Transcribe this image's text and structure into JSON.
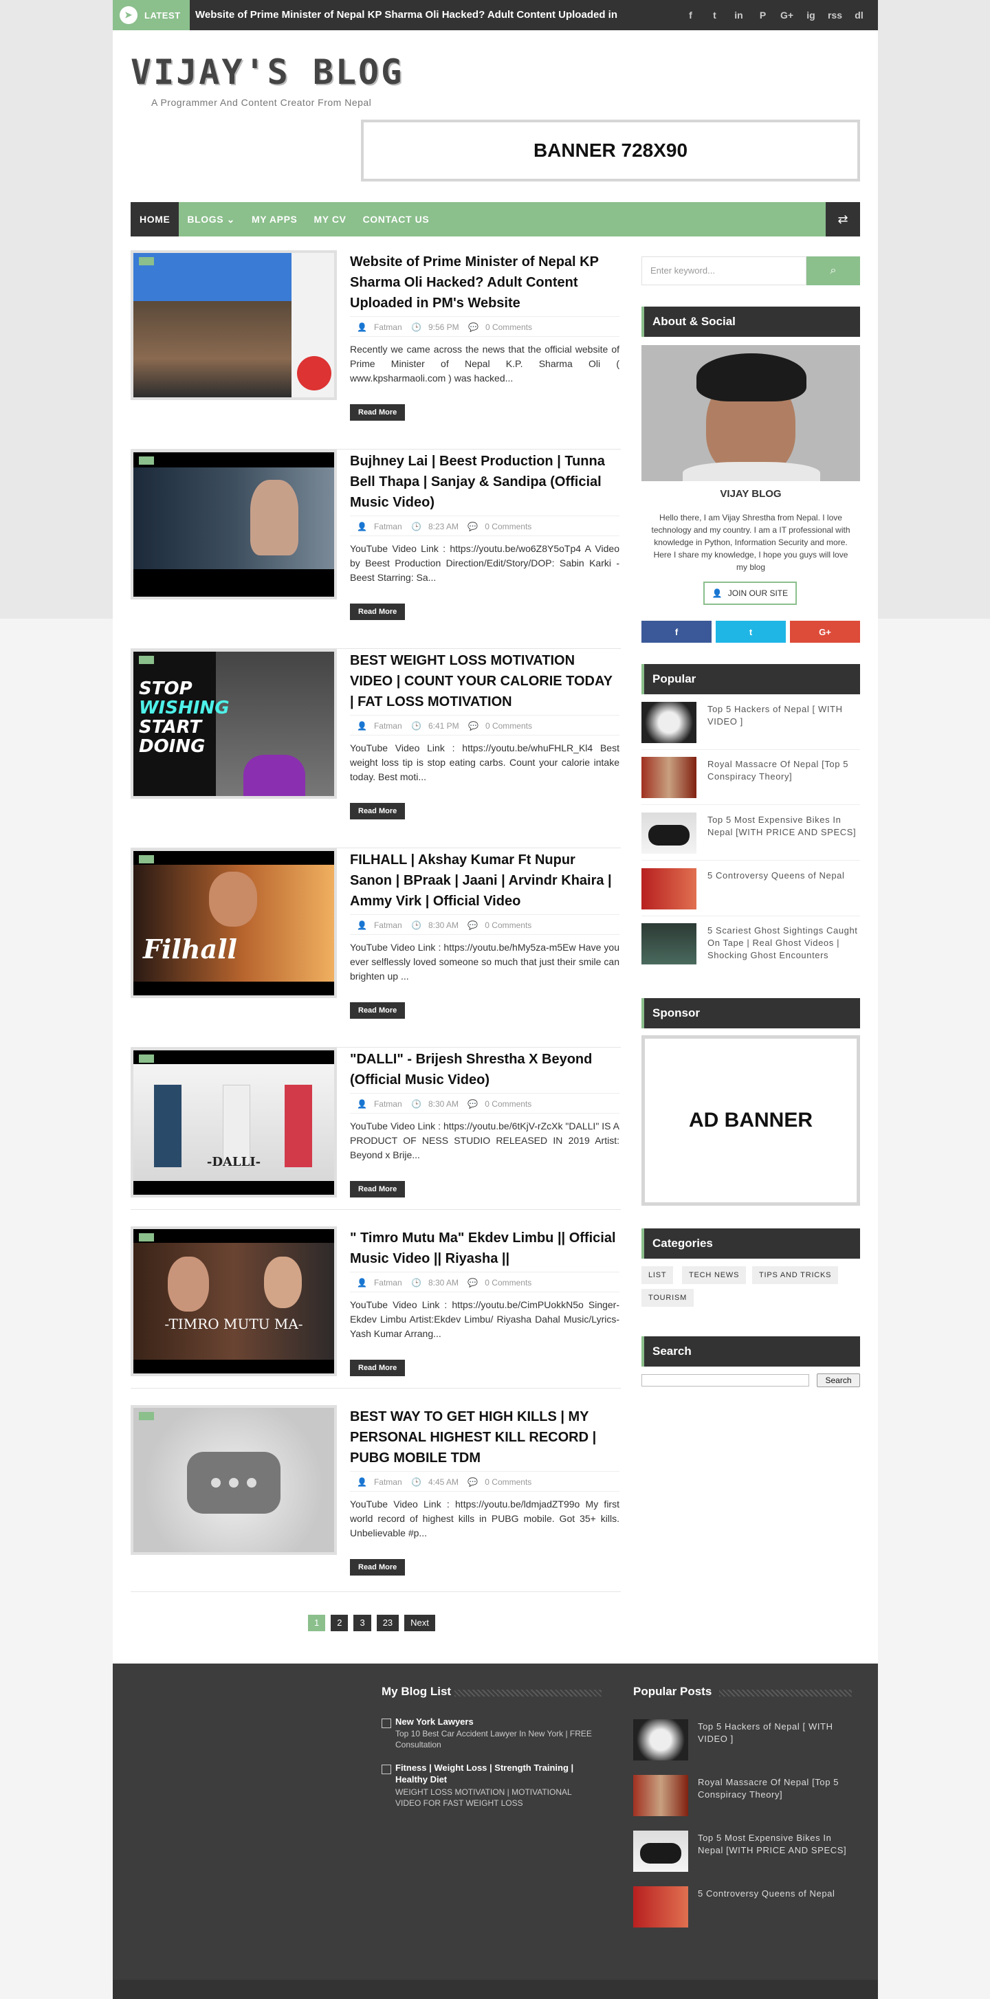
{
  "topbar": {
    "latest_label": "LATEST",
    "ticker": "Website of Prime Minister of Nepal KP Sharma Oli Hacked? Adult Content Uploaded in",
    "social": [
      "f",
      "t",
      "in",
      "P",
      "G+",
      "ig",
      "rss",
      "dl"
    ]
  },
  "header": {
    "logo": "VIJAY'S BLOG",
    "tagline": "A Programmer And Content Creator From Nepal",
    "banner": "BANNER 728X90"
  },
  "nav": {
    "items": [
      "HOME",
      "BLOGS ⌄",
      "MY APPS",
      "MY CV",
      "CONTACT US"
    ]
  },
  "posts": [
    {
      "title": "Website of Prime Minister of Nepal KP Sharma Oli Hacked? Adult Content Uploaded in PM's Website",
      "author": "Fatman",
      "time": "9:56 PM",
      "comments": "0 Comments",
      "excerpt": "Recently we came across the news that the official website of Prime Minister of Nepal K.P. Sharma Oli ( www.kpsharmaoli.com ) was hacked...",
      "read_more": "Read More"
    },
    {
      "title": "Bujhney Lai | Beest Production | Tunna Bell Thapa | Sanjay & Sandipa (Official Music Video)",
      "author": "Fatman",
      "time": "8:23 AM",
      "comments": "0 Comments",
      "excerpt": "YouTube Video Link : https://youtu.be/wo6Z8Y5oTp4 A Video by Beest Production Direction/Edit/Story/DOP: Sabin Karki -Beest Starring: Sa...",
      "read_more": "Read More"
    },
    {
      "title": "BEST WEIGHT LOSS MOTIVATION VIDEO | COUNT YOUR CALORIE TODAY | FAT LOSS MOTIVATION",
      "author": "Fatman",
      "time": "6:41 PM",
      "comments": "0 Comments",
      "excerpt": "YouTube Video Link : https://youtu.be/whuFHLR_Kl4 Best weight loss tip is stop eating carbs. Count your calorie intake today. Best moti...",
      "read_more": "Read More",
      "thumb_text": [
        "STOP",
        "WISHING",
        "START",
        "DOING"
      ]
    },
    {
      "title": "FILHALL | Akshay Kumar Ft Nupur Sanon | BPraak | Jaani | Arvindr Khaira | Ammy Virk | Official Video",
      "author": "Fatman",
      "time": "8:30 AM",
      "comments": "0 Comments",
      "excerpt": "YouTube Video Link : https://youtu.be/hMy5za-m5Ew Have you ever selflessly loved someone so much that just their smile can brighten up ...",
      "read_more": "Read More",
      "thumb_text": "Filhall"
    },
    {
      "title": "\"DALLI\" - Brijesh Shrestha X Beyond (Official Music Video)",
      "author": "Fatman",
      "time": "8:30 AM",
      "comments": "0 Comments",
      "excerpt": "YouTube Video Link : https://youtu.be/6tKjV-rZcXk \"DALLI\" IS A PRODUCT OF NESS STUDIO RELEASED IN 2019 Artist: Beyond x Brije...",
      "read_more": "Read More",
      "thumb_text": "-DALLI-"
    },
    {
      "title": "\" Timro Mutu Ma\" Ekdev Limbu || Official Music Video || Riyasha ||",
      "author": "Fatman",
      "time": "8:30 AM",
      "comments": "0 Comments",
      "excerpt": "YouTube Video Link : https://youtu.be/CimPUokkN5o Singer- Ekdev Limbu Artist:Ekdev Limbu/ Riyasha Dahal Music/Lyrics- Yash Kumar Arrang...",
      "read_more": "Read More",
      "thumb_text": "-TIMRO MUTU MA-"
    },
    {
      "title": "BEST WAY TO GET HIGH KILLS | MY PERSONAL HIGHEST KILL RECORD | PUBG MOBILE TDM",
      "author": "Fatman",
      "time": "4:45 AM",
      "comments": "0 Comments",
      "excerpt": "YouTube Video Link : https://youtu.be/ldmjadZT99o My first world record of highest kills in PUBG mobile. Got 35+ kills. Unbelievable #p...",
      "read_more": "Read More"
    }
  ],
  "pagination": [
    "1",
    "2",
    "3",
    "23",
    "Next"
  ],
  "sidebar": {
    "search_placeholder": "Enter keyword...",
    "about_title": "About & Social",
    "about_name": "VIJAY BLOG",
    "about_text": "Hello there, I am Vijay Shrestha from Nepal. I love technology and my country. I am a IT professional with knowledge in Python, Information Security and more. Here I share my knowledge, I hope you guys will love my blog",
    "join_label": "JOIN OUR SITE",
    "share": [
      {
        "label": "f",
        "color": "#3b5998"
      },
      {
        "label": "t",
        "color": "#1da1f2"
      },
      {
        "label": "G+",
        "color": "#dd4b39"
      }
    ],
    "popular_title": "Popular",
    "popular": [
      "Top 5 Hackers of Nepal [ WITH VIDEO ]",
      "Royal Massacre Of Nepal [Top 5 Conspiracy Theory]",
      "Top 5 Most Expensive Bikes In Nepal [WITH PRICE AND SPECS]",
      "5 Controversy Queens of Nepal",
      "5 Scariest Ghost Sightings Caught On Tape | Real Ghost Videos | Shocking Ghost Encounters"
    ],
    "sponsor_title": "Sponsor",
    "ad_banner": "AD BANNER",
    "categories_title": "Categories",
    "categories": [
      "LIST",
      "TECH NEWS",
      "TIPS AND TRICKS",
      "TOURISM"
    ],
    "search_title": "Search",
    "search_button": "Search"
  },
  "footer": {
    "blog_list_title": "My Blog List",
    "blog_list": [
      {
        "title": "New York Lawyers",
        "sub": "Top 10 Best Car Accident Lawyer In New York | FREE Consultation"
      },
      {
        "title": "Fitness | Weight Loss | Strength Training | Healthy Diet",
        "sub": "WEIGHT LOSS MOTIVATION | MOTIVATIONAL VIDEO FOR FAST WEIGHT LOSS"
      }
    ],
    "popular_title": "Popular Posts",
    "popular": [
      "Top 5 Hackers of Nepal [ WITH VIDEO ]",
      "Royal Massacre Of Nepal [Top 5 Conspiracy Theory]",
      "Top 5 Most Expensive Bikes In Nepal [WITH PRICE AND SPECS]",
      "5 Controversy Queens of Nepal"
    ]
  },
  "colors": {
    "accent": "#8bbf8c",
    "dark": "#333333"
  }
}
